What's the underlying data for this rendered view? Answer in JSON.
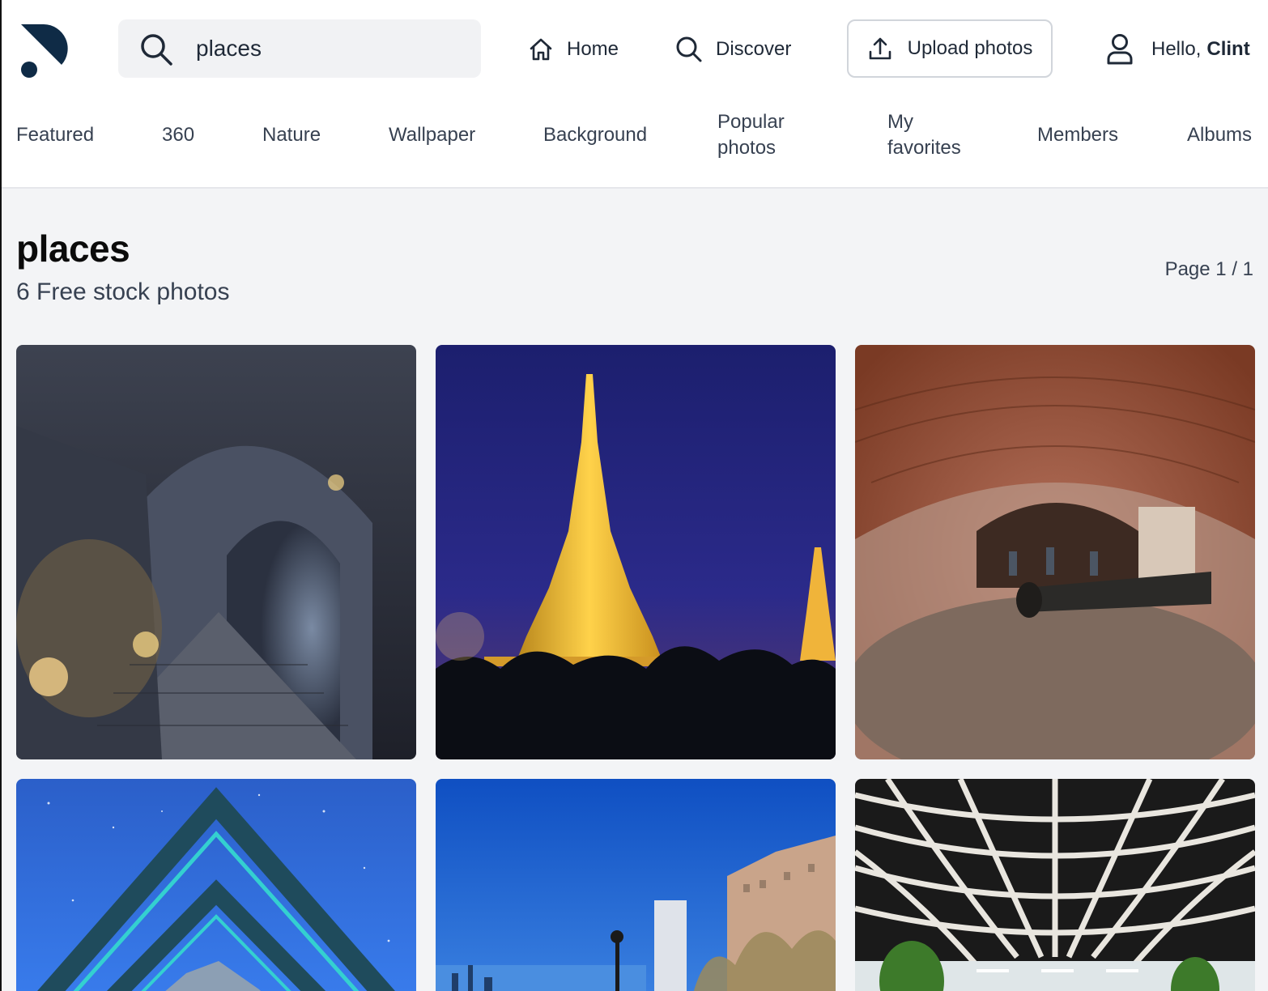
{
  "search": {
    "query": "places"
  },
  "nav": {
    "home": "Home",
    "discover": "Discover",
    "upload": "Upload photos",
    "greeting": "Hello,",
    "username": "Clint"
  },
  "categories": {
    "featured": "Featured",
    "c360": "360",
    "nature": "Nature",
    "wallpaper": "Wallpaper",
    "background": "Background",
    "popular_1": "Popular",
    "popular_2": "photos",
    "favorites_1": "My",
    "favorites_2": "favorites",
    "members": "Members",
    "albums": "Albums"
  },
  "results": {
    "title": "places",
    "count_label": "6 Free stock photos",
    "page": "Page 1 / 1"
  },
  "photos": [
    {
      "subject": "dungeon-corridor"
    },
    {
      "subject": "golden-pagoda"
    },
    {
      "subject": "brick-vault-cannon-360"
    },
    {
      "subject": "starry-sky-triangles"
    },
    {
      "subject": "waterfront-city"
    },
    {
      "subject": "ceiling-lattice-360"
    }
  ],
  "colors": {
    "accent": "#0f2b46",
    "page_bg": "#f3f4f6"
  }
}
